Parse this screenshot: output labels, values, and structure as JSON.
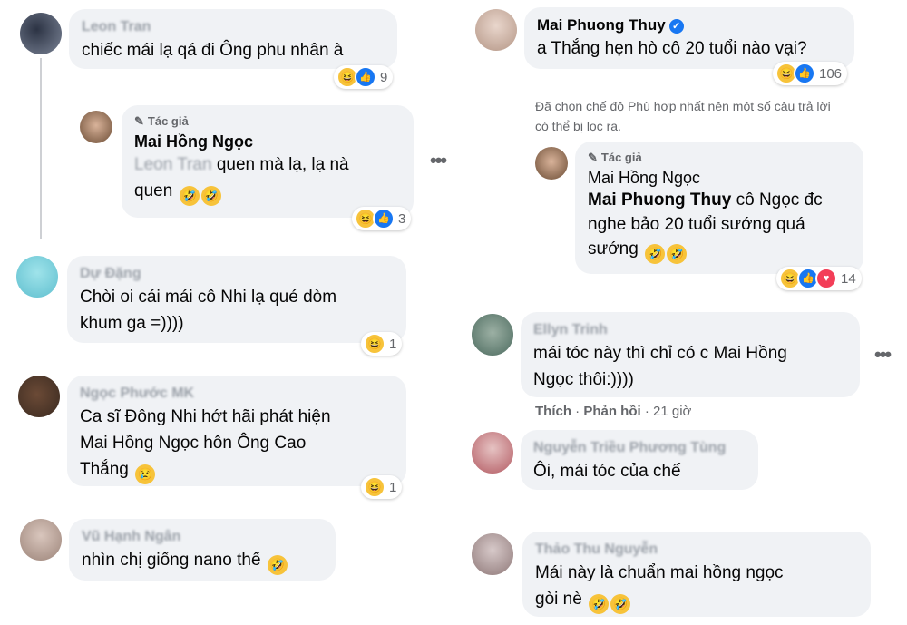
{
  "left": {
    "c1": {
      "name": "Leon Tran",
      "text": "chiếc mái lạ qá đi Ông phu nhân à",
      "count": "9"
    },
    "r1": {
      "author_label": "Tác giả",
      "name": "Mai Hồng Ngọc",
      "mention": "Leon Tran",
      "text_a": " quen mà lạ, lạ nà",
      "text_b": "quen",
      "count": "3"
    },
    "c2": {
      "name": "Dự Đặng",
      "text_a": "Chòi oi cái mái cô Nhi lạ qué dòm",
      "text_b": "khum ga =))))",
      "count": "1"
    },
    "c3": {
      "name": "Ngọc Phước MK",
      "text_a": "Ca sĩ Đông Nhi hớt hãi phát hiện",
      "text_b": "Mai Hồng Ngọc hôn Ông Cao",
      "text_c": "Thắng",
      "count": "1"
    },
    "c4": {
      "name": "Vũ Hạnh Ngân",
      "text": "nhìn chị giống nano thế"
    }
  },
  "right": {
    "c1": {
      "name": "Mai Phuong Thuy",
      "text": "a Thắng hẹn hò cô 20 tuổi nào vại?",
      "count": "106"
    },
    "filter_note": [
      "Đã chọn chế độ Phù hợp nhất nên một số câu trả lời",
      "có thể bị lọc ra."
    ],
    "r1": {
      "author_label": "Tác giả",
      "name": "Mai Hồng Ngọc",
      "mention": "Mai Phuong Thuy",
      "text_a": " cô Ngọc đc",
      "text_b": "nghe bảo 20 tuổi sướng quá",
      "text_c": "sướng",
      "count": "14"
    },
    "c2": {
      "name": "Ellyn Trinh",
      "text_a": "mái tóc này thì chỉ có c Mai Hồng",
      "text_b": "Ngọc thôi:))))"
    },
    "actions": {
      "like": "Thích",
      "reply": "Phản hồi",
      "sep": " · ",
      "time": "21 giờ"
    },
    "c3": {
      "name": "Nguyễn Triều Phương Tùng",
      "text": "Ôi, mái tóc của chế"
    },
    "c4": {
      "name": "Thảo Thu Nguyễn",
      "text_a": "Mái này là chuẩn mai hồng ngọc",
      "text_b": "gòi nè"
    }
  },
  "colors": {
    "bubble": "#f0f2f5",
    "like_blue": "#1877f2",
    "love_red": "#f33e58",
    "haha_yellow": "#f7c33a"
  },
  "icons": [
    "haha-icon",
    "like-icon",
    "love-icon",
    "cry-icon",
    "pencil-icon",
    "verified-icon",
    "more-icon"
  ]
}
